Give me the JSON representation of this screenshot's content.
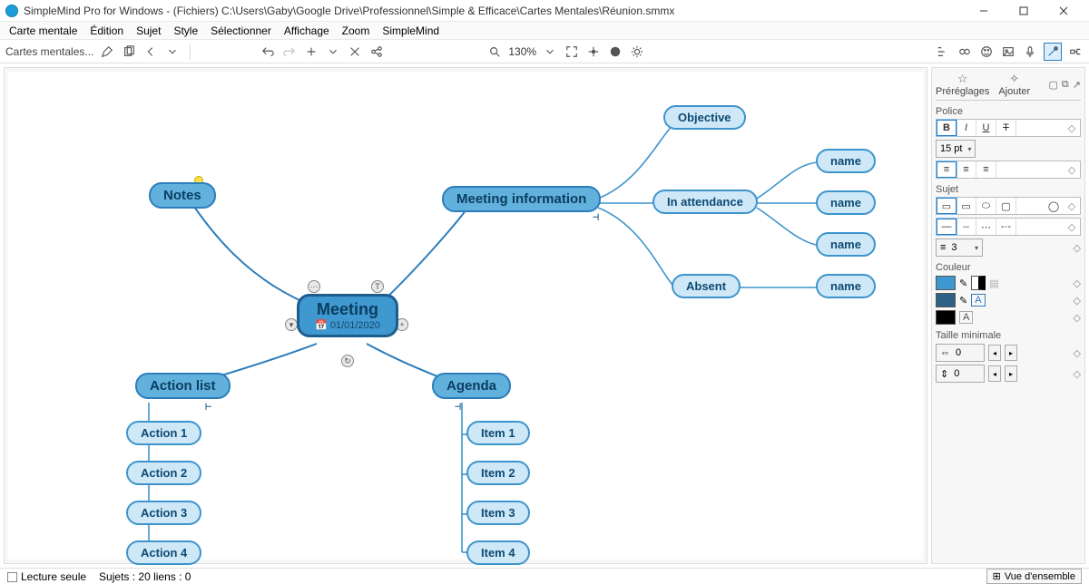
{
  "window": {
    "title": "SimpleMind Pro for Windows - (Fichiers) C:\\Users\\Gaby\\Google Drive\\Professionnel\\Simple & Efficace\\Cartes Mentales\\Réunion.smmx"
  },
  "menu": [
    "Carte mentale",
    "Édition",
    "Sujet",
    "Style",
    "Sélectionner",
    "Affichage",
    "Zoom",
    "SimpleMind"
  ],
  "toolbar": {
    "tab": "Cartes mentales...",
    "zoom": "130%"
  },
  "sidepanel": {
    "tabs": {
      "presets": "Préréglages",
      "add": "Ajouter"
    },
    "font": {
      "label": "Police",
      "size": "15 pt"
    },
    "subject": {
      "label": "Sujet",
      "border": "3"
    },
    "color": {
      "label": "Couleur"
    },
    "minSize": {
      "label": "Taille minimale",
      "w": "0",
      "h": "0"
    }
  },
  "statusbar": {
    "readonly": "Lecture seule",
    "counts": "Sujets : 20 liens : 0",
    "overview": "Vue d'ensemble"
  },
  "mindmap": {
    "root": {
      "title": "Meeting",
      "date": "01/01/2020"
    },
    "notes": "Notes",
    "meetingInfo": "Meeting information",
    "objective": "Objective",
    "attendance": "In attendance",
    "absent": "Absent",
    "name": "name",
    "agenda": "Agenda",
    "items": [
      "Item 1",
      "Item 2",
      "Item 3",
      "Item 4"
    ],
    "actionList": "Action list",
    "actions": [
      "Action 1",
      "Action 2",
      "Action 3",
      "Action 4"
    ]
  }
}
